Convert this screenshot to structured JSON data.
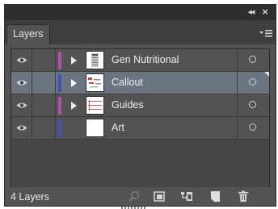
{
  "panel": {
    "tab_label": "Layers",
    "collapse_glyph": "◂◂",
    "close_glyph": "×",
    "menu_icon": "panel-menu-icon"
  },
  "layers": [
    {
      "name": "Gen Nutritional",
      "color": "#b14fa9",
      "visible": true,
      "expandable": true,
      "selected": false
    },
    {
      "name": "Callout",
      "color": "#3d54b5",
      "visible": true,
      "expandable": true,
      "selected": true
    },
    {
      "name": "Guides",
      "color": "#b14fa9",
      "visible": true,
      "expandable": true,
      "selected": false
    },
    {
      "name": "Art",
      "color": "#3d54b5",
      "visible": true,
      "expandable": false,
      "selected": false
    }
  ],
  "footer": {
    "count_label": "4 Layers",
    "buttons": [
      "search-icon",
      "clipping-mask-icon",
      "new-sublayer-icon",
      "new-layer-icon",
      "trash-icon"
    ]
  },
  "colors": {
    "panel_bg": "#535353",
    "selected_row": "#6a7581",
    "titlebar": "#2e2e2e"
  }
}
